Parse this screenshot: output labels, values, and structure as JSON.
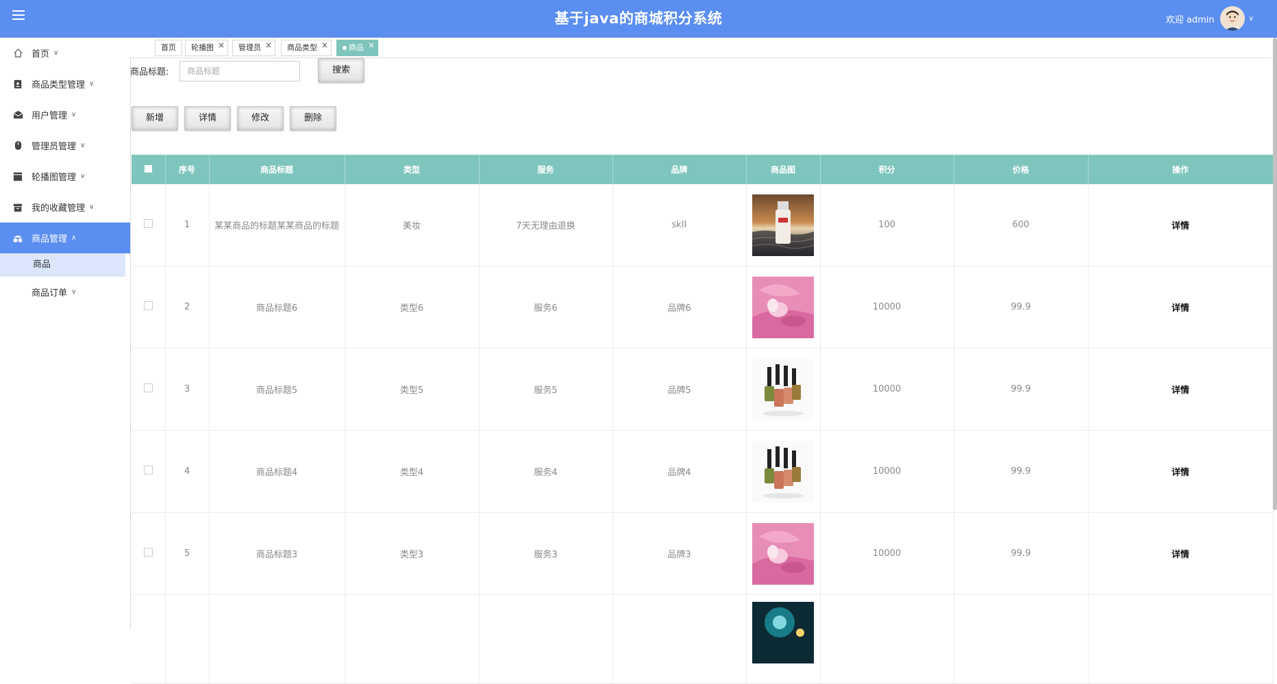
{
  "header": {
    "title": "基于java的商城积分系统",
    "welcome": "欢迎 admin",
    "brand_color": "#5a8ef0"
  },
  "sidebar": {
    "items": [
      {
        "label": "首页",
        "icon": "home-icon"
      },
      {
        "label": "商品类型管理",
        "icon": "category-icon"
      },
      {
        "label": "用户管理",
        "icon": "envelope-icon"
      },
      {
        "label": "管理员管理",
        "icon": "mouse-icon"
      },
      {
        "label": "轮播图管理",
        "icon": "carousel-icon"
      },
      {
        "label": "我的收藏管理",
        "icon": "archive-icon"
      },
      {
        "label": "商品管理",
        "icon": "goods-icon"
      }
    ],
    "sub_goods": "商品",
    "sub_orders": "商品订单"
  },
  "tabs": [
    {
      "label": "首页"
    },
    {
      "label": "轮播图"
    },
    {
      "label": "管理员"
    },
    {
      "label": "商品类型"
    },
    {
      "label": "商品"
    }
  ],
  "search": {
    "label": "商品标题:",
    "placeholder": "商品标题",
    "button": "搜索"
  },
  "actions": {
    "add": "新增",
    "detail": "详情",
    "edit": "修改",
    "delete": "删除"
  },
  "table": {
    "header_color": "#7ec5bd",
    "columns": [
      "序号",
      "商品标题",
      "类型",
      "服务",
      "品牌",
      "商品图",
      "积分",
      "价格",
      "操作"
    ],
    "rows": [
      {
        "no": "1",
        "title": "某某商品的标题某某商品的标题",
        "type": "美妆",
        "service": "7天无理由退换",
        "brand": "skII",
        "image": "skii-bottle",
        "points": "100",
        "price": "600",
        "op": "详情"
      },
      {
        "no": "2",
        "title": "商品标题6",
        "type": "类型6",
        "service": "服务6",
        "brand": "品牌6",
        "image": "pink-sponge",
        "points": "10000",
        "price": "99.9",
        "op": "详情"
      },
      {
        "no": "3",
        "title": "商品标题5",
        "type": "类型5",
        "service": "服务5",
        "brand": "品牌5",
        "image": "nail-polish",
        "points": "10000",
        "price": "99.9",
        "op": "详情"
      },
      {
        "no": "4",
        "title": "商品标题4",
        "type": "类型4",
        "service": "服务4",
        "brand": "品牌4",
        "image": "nail-polish",
        "points": "10000",
        "price": "99.9",
        "op": "详情"
      },
      {
        "no": "5",
        "title": "商品标题3",
        "type": "类型3",
        "service": "服务3",
        "brand": "品牌3",
        "image": "pink-sponge",
        "points": "10000",
        "price": "99.9",
        "op": "详情"
      }
    ]
  }
}
